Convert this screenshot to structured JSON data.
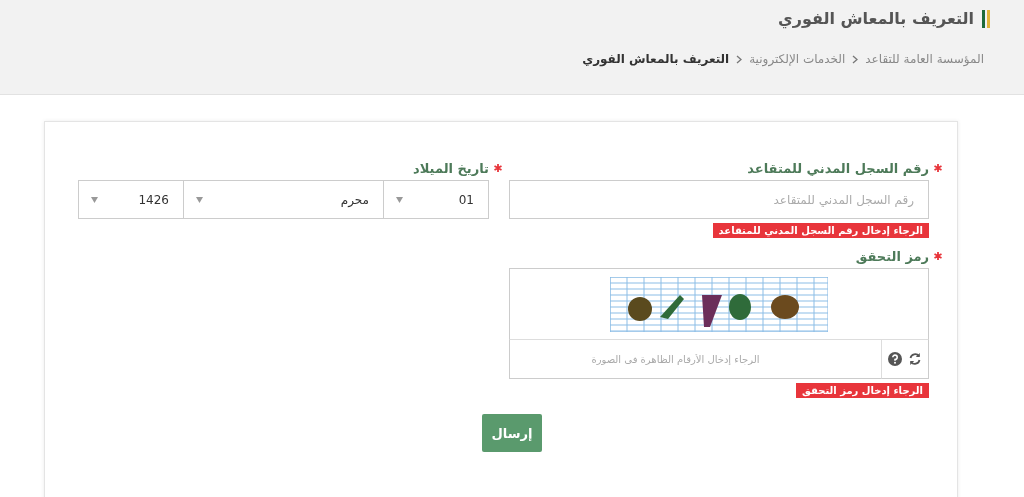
{
  "header": {
    "title": "التعريف بالمعاش الفوري",
    "breadcrumb": [
      {
        "label": "المؤسسة العامة للتقاعد",
        "current": false
      },
      {
        "label": "الخدمات الإلكترونية",
        "current": false
      },
      {
        "label": "التعريف بالمعاش الفوري",
        "current": true
      }
    ]
  },
  "form": {
    "civil_id": {
      "label": "رقم السجل المدني للمتقاعد",
      "required": true,
      "placeholder": "رقم السجل المدني للمتقاعد",
      "error": "الرجاء إدخال رقم السجل المدني للمتقاعد"
    },
    "birth_date": {
      "label": "تاريخ الميلاد",
      "required": true,
      "selects": [
        {
          "value": "01"
        },
        {
          "value": "محرم"
        },
        {
          "value": "1426"
        }
      ]
    },
    "captcha": {
      "label": "رمز التحقق",
      "required": true,
      "placeholder": "الرجاء إدخال الأرقام الظاهرة في الصورة",
      "error": "الرجاء إدخال رمز التحقق"
    },
    "submit": "إرسال"
  }
}
